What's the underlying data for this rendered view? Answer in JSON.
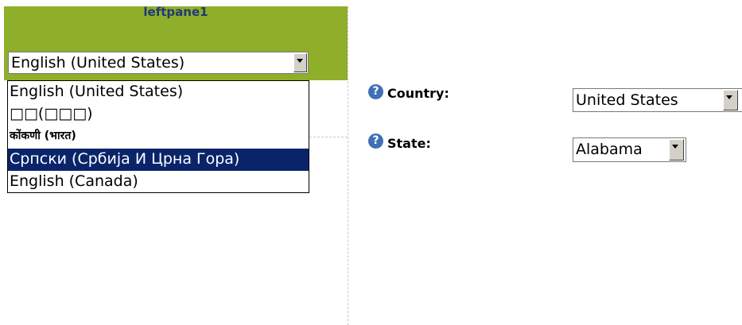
{
  "leftpane": {
    "title": "leftpane1",
    "language_select": {
      "value": "English (United States)",
      "options": [
        "English (United States)",
        "□□(□□□)",
        "कोंकणी (भारत)",
        "Српски (Србија И Црна Гора)",
        "English (Canada)"
      ],
      "highlighted_index": 3
    }
  },
  "form": {
    "country_label": "Country:",
    "country_value": "United States",
    "state_label": "State:",
    "state_value": "Alabama",
    "help_icon_glyph": "?"
  },
  "colors": {
    "header_green": "#8fae2a",
    "title_blue": "#1e3a78",
    "highlight": "#0a246a",
    "help_icon": "#3f6fb4"
  }
}
